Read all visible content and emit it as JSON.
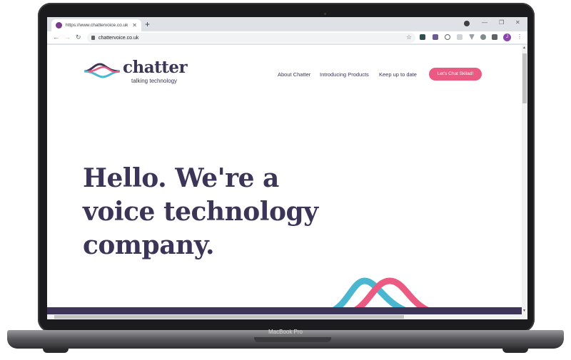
{
  "device": {
    "label": "MacBook Pro"
  },
  "browser": {
    "tab_title": "https://www.chattervoice.co.uk",
    "tab_close": "✕",
    "new_tab": "+",
    "url": "chattervoice.co.uk",
    "profile_initial": "J",
    "icons": [
      "back-icon",
      "forward-icon",
      "reload-icon",
      "lock-icon",
      "star-icon",
      "extension-icons",
      "puzzle-icon",
      "kebab-icon"
    ]
  },
  "site": {
    "logo_word": "chatter",
    "logo_tagline": "talking technology",
    "nav": [
      "About Chatter",
      "Introducing Products",
      "Keep up to date"
    ],
    "cta": "Let's Chat Skilad!",
    "hero_lines": [
      "Hello. We're a",
      "voice technology",
      "company."
    ]
  },
  "colors": {
    "brand_navy": "#3c3558",
    "brand_pink": "#ea5a82",
    "brand_teal": "#4ab6cf"
  }
}
